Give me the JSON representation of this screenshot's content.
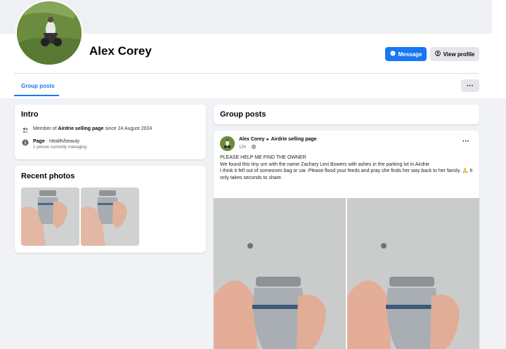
{
  "profile": {
    "name": "Alex Corey",
    "message_label": "Message",
    "view_profile_label": "View profile"
  },
  "tabs": [
    {
      "label": "Group posts",
      "active": true
    }
  ],
  "more_label": "···",
  "intro": {
    "title": "Intro",
    "member_prefix": "Member of ",
    "group_name": "Airdrie selling page",
    "member_suffix": " since 24 August 2024",
    "page_label": "Page",
    "page_category": " · Health/beauty",
    "page_sub": "1 person currently managing"
  },
  "recent_photos": {
    "title": "Recent photos"
  },
  "group_posts": {
    "title": "Group posts"
  },
  "post": {
    "author": "Alex Corey",
    "arrow": "▸",
    "group": "Airdrie selling page",
    "time": "12h",
    "more": "···",
    "lines": [
      "PLEASE HELP ME FIND THE OWNER",
      "We found this tiny urn with the name Zachary Levi Bowers with ashes in the parking lot in Airdrie",
      "I think it fell out of someones bag or car. Please flood your feeds and pray she finds her way back to her family. 🙏 It only takes seconds to share."
    ]
  },
  "colors": {
    "accent": "#1877f2",
    "page_bg": "#f0f2f5",
    "card_bg": "#ffffff"
  },
  "icons": {
    "message": "messenger-icon",
    "view_profile": "user-icon",
    "member": "group-icon",
    "page": "info-icon",
    "privacy": "globe-icon"
  }
}
